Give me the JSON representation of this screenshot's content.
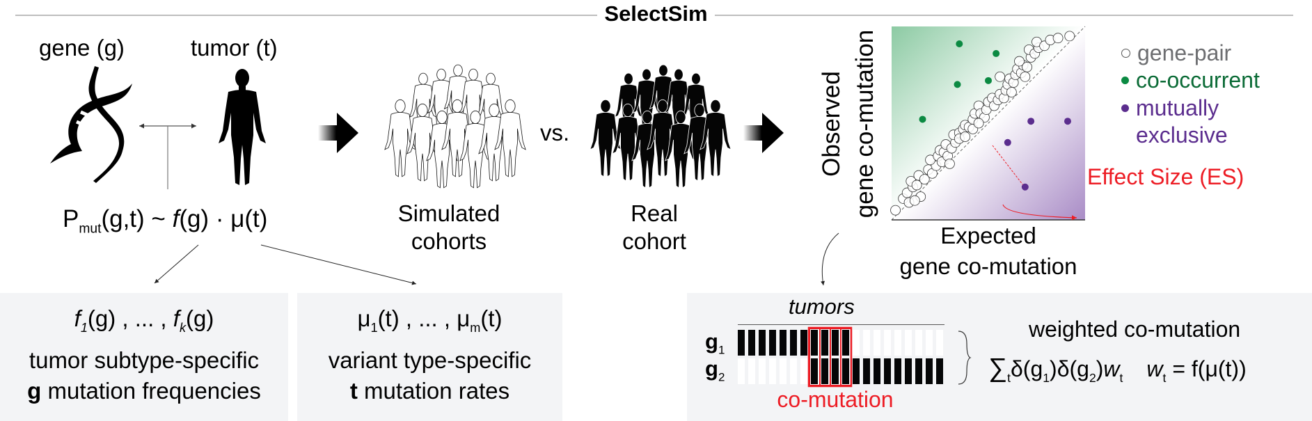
{
  "title": "SelectSim",
  "model": {
    "gene_label": "gene (g)",
    "tumor_label": "tumor (t)",
    "formula": {
      "P": "P",
      "P_sub": "mut",
      "args": "(g,t) ~ ",
      "f": "f",
      "f_args": "(g)",
      "dot": " · ",
      "mu": "μ",
      "mu_args": "(t)"
    }
  },
  "cohorts": {
    "simulated_label_1": "Simulated",
    "simulated_label_2": "cohorts",
    "vs_label": "vs.",
    "real_label_1": "Real",
    "real_label_2": "cohort"
  },
  "panels": {
    "gene_freq": {
      "f1": "f",
      "f1_sub": "1",
      "f1_args": "(g) , ... , ",
      "fk": "f",
      "fk_sub": "k",
      "fk_args": "(g)",
      "line1": "tumor subtype-specific",
      "line2_bold": "g",
      "line2_rest": " mutation frequencies"
    },
    "tumor_rate": {
      "mu1": "μ",
      "mu1_sub": "1",
      "mu1_args": "(t) , ... , ",
      "mum": "μ",
      "mum_sub": "m",
      "mum_args": "(t)",
      "line1": "variant type-specific",
      "line2_bold": "t",
      "line2_rest": " mutation rates"
    }
  },
  "scatter": {
    "ylabel_1": "Observed",
    "ylabel_2": "gene co-mutation",
    "xlabel_1": "Expected",
    "xlabel_2": "gene co-mutation",
    "effect_size_label": "Effect Size (ES)",
    "legend": [
      {
        "label": "gene-pair",
        "color": "#6d6e71",
        "dot": "#ffffff"
      },
      {
        "label": "co-occurrent",
        "color": "#0b6b36",
        "dot": "#0b8a42"
      },
      {
        "label": "mutually",
        "color": "#5b2d8e",
        "dot": "#5b2d8e"
      },
      {
        "label": "exclusive",
        "color": "#5b2d8e",
        "dot": null
      }
    ],
    "colors": {
      "green_bg": "#8ccaa3",
      "purple_bg": "#a98cc6",
      "co_occurrent": "#0b8a42",
      "mutually_exclusive": "#5b2d8e",
      "effect": "#ed1c24"
    }
  },
  "chart_data": {
    "type": "scatter",
    "title": "",
    "xlabel": "Expected gene co-mutation",
    "ylabel": "Observed gene co-mutation",
    "xlim": [
      0,
      1
    ],
    "ylim": [
      0,
      1
    ],
    "grid": false,
    "legend": "right",
    "series": [
      {
        "name": "co-occurrent",
        "points": [
          [
            0.35,
            0.91
          ],
          [
            0.54,
            0.86
          ],
          [
            0.34,
            0.7
          ],
          [
            0.5,
            0.72
          ],
          [
            0.16,
            0.52
          ]
        ]
      },
      {
        "name": "mutually exclusive",
        "points": [
          [
            0.72,
            0.51
          ],
          [
            0.91,
            0.51
          ],
          [
            0.6,
            0.4
          ],
          [
            0.69,
            0.17
          ]
        ]
      },
      {
        "name": "gene-pair",
        "points": [
          [
            0.02,
            0.05
          ],
          [
            0.06,
            0.11
          ],
          [
            0.08,
            0.14
          ],
          [
            0.09,
            0.09
          ],
          [
            0.11,
            0.17
          ],
          [
            0.1,
            0.2
          ],
          [
            0.13,
            0.18
          ],
          [
            0.15,
            0.12
          ],
          [
            0.14,
            0.23
          ],
          [
            0.17,
            0.21
          ],
          [
            0.19,
            0.26
          ],
          [
            0.21,
            0.24
          ],
          [
            0.23,
            0.28
          ],
          [
            0.2,
            0.31
          ],
          [
            0.24,
            0.33
          ],
          [
            0.26,
            0.3
          ],
          [
            0.25,
            0.36
          ],
          [
            0.27,
            0.35
          ],
          [
            0.28,
            0.39
          ],
          [
            0.29,
            0.33
          ],
          [
            0.31,
            0.37
          ],
          [
            0.33,
            0.4
          ],
          [
            0.32,
            0.44
          ],
          [
            0.35,
            0.45
          ],
          [
            0.35,
            0.42
          ],
          [
            0.37,
            0.47
          ],
          [
            0.38,
            0.49
          ],
          [
            0.4,
            0.48
          ],
          [
            0.42,
            0.47
          ],
          [
            0.42,
            0.52
          ],
          [
            0.43,
            0.55
          ],
          [
            0.45,
            0.59
          ],
          [
            0.46,
            0.55
          ],
          [
            0.48,
            0.53
          ],
          [
            0.49,
            0.57
          ],
          [
            0.5,
            0.61
          ],
          [
            0.52,
            0.63
          ],
          [
            0.53,
            0.59
          ],
          [
            0.55,
            0.62
          ],
          [
            0.56,
            0.65
          ],
          [
            0.58,
            0.63
          ],
          [
            0.59,
            0.67
          ],
          [
            0.6,
            0.7
          ],
          [
            0.61,
            0.73
          ],
          [
            0.63,
            0.71
          ],
          [
            0.64,
            0.75
          ],
          [
            0.65,
            0.78
          ],
          [
            0.67,
            0.76
          ],
          [
            0.68,
            0.8
          ],
          [
            0.66,
            0.82
          ],
          [
            0.7,
            0.79
          ],
          [
            0.72,
            0.84
          ],
          [
            0.71,
            0.88
          ],
          [
            0.74,
            0.86
          ],
          [
            0.76,
            0.89
          ],
          [
            0.75,
            0.92
          ],
          [
            0.79,
            0.9
          ],
          [
            0.82,
            0.93
          ],
          [
            0.86,
            0.94
          ],
          [
            0.92,
            0.95
          ],
          [
            0.56,
            0.74
          ],
          [
            0.38,
            0.43
          ],
          [
            0.3,
            0.29
          ],
          [
            0.12,
            0.1
          ],
          [
            0.62,
            0.66
          ],
          [
            0.69,
            0.74
          ],
          [
            0.45,
            0.5
          ]
        ]
      }
    ]
  },
  "comutation": {
    "tumors_label": "tumors",
    "g1_label": "g",
    "g1_sub": "1",
    "g2_label": "g",
    "g2_sub": "2",
    "comutation_label": "co-mutation",
    "n_tumors": 20,
    "g1_mutated": [
      1,
      1,
      1,
      1,
      1,
      1,
      1,
      1,
      1,
      1,
      1,
      0,
      0,
      0,
      0,
      0,
      0,
      0,
      0,
      0
    ],
    "g2_mutated": [
      0,
      0,
      0,
      0,
      0,
      0,
      0,
      1,
      1,
      1,
      1,
      1,
      1,
      1,
      1,
      1,
      1,
      1,
      1,
      1
    ],
    "weighted_label": "weighted co-mutation",
    "formula": {
      "sum": "∑",
      "sum_sub": "t",
      "d1": "δ(g",
      "d1_sub": "1",
      "d2": ")δ(g",
      "d2_sub": "2",
      "d2_close": ")",
      "w": "w",
      "w_sub": "t",
      "w2": "w",
      "w2_sub": "t",
      "eq": " = f(μ(t))"
    }
  }
}
